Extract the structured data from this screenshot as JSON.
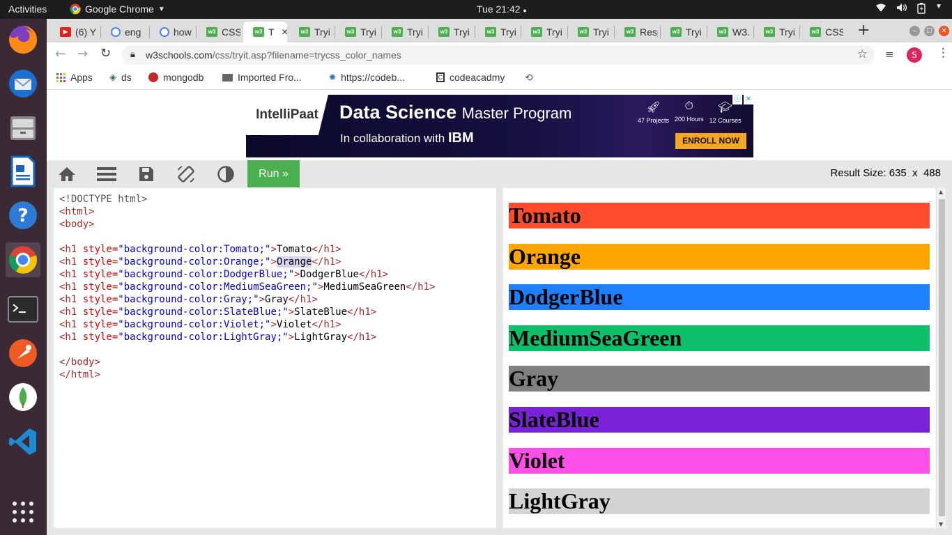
{
  "system": {
    "activities": "Activities",
    "app_name": "Google Chrome",
    "clock": "Tue 21:42"
  },
  "tabs": [
    {
      "label": "(6) Y",
      "icon": "youtube-icon"
    },
    {
      "label": "eng",
      "icon": "google-icon"
    },
    {
      "label": "how",
      "icon": "google-icon"
    },
    {
      "label": "CSS",
      "icon": "w3schools-icon"
    },
    {
      "label": "T",
      "icon": "w3schools-icon",
      "active": true
    },
    {
      "label": "Tryi",
      "icon": "w3schools-icon"
    },
    {
      "label": "Tryi",
      "icon": "w3schools-icon"
    },
    {
      "label": "Tryi",
      "icon": "w3schools-icon"
    },
    {
      "label": "Tryi",
      "icon": "w3schools-icon"
    },
    {
      "label": "Tryi",
      "icon": "w3schools-icon"
    },
    {
      "label": "Tryi",
      "icon": "w3schools-icon"
    },
    {
      "label": "Tryi",
      "icon": "w3schools-icon"
    },
    {
      "label": "Resp",
      "icon": "w3schools-icon"
    },
    {
      "label": "Tryi",
      "icon": "w3schools-icon"
    },
    {
      "label": "W3.",
      "icon": "w3schools-icon"
    },
    {
      "label": "Tryi",
      "icon": "w3schools-icon"
    },
    {
      "label": "CSS",
      "icon": "w3schools-icon"
    }
  ],
  "address": {
    "host": "w3schools.com",
    "path": "/css/tryit.asp?filename=trycss_color_names",
    "profile_initial": "S"
  },
  "bookmarks": [
    {
      "label": "Apps",
      "icon": "apps-grid-icon"
    },
    {
      "label": "ds",
      "icon": "diamond-icon"
    },
    {
      "label": "mongodb",
      "icon": "mongodb-icon"
    },
    {
      "label": "Imported Fro...",
      "icon": "folder-icon"
    },
    {
      "label": "https://codeb...",
      "icon": "codebeautify-icon"
    },
    {
      "label": "codeacadmy",
      "icon": "codecademy-icon"
    }
  ],
  "ad": {
    "logo": "IntelliPaat",
    "headline_bold": "Data Science",
    "headline_rest": "Master Program",
    "collab": "In collaboration with",
    "partner": "IBM",
    "stats": [
      "47 Projects",
      "200 Hours",
      "12 Courses"
    ],
    "cta": "ENROLL NOW"
  },
  "toolbar": {
    "run_label": "Run »",
    "result_size_label": "Result Size:",
    "result_width": "635",
    "times": "x",
    "result_height": "488"
  },
  "code_lines": [
    [
      {
        "t": "doc",
        "s": "<!DOCTYPE html>"
      }
    ],
    [
      {
        "t": "tag",
        "s": "<html>"
      }
    ],
    [
      {
        "t": "tag",
        "s": "<body>"
      }
    ],
    [],
    [
      {
        "t": "tag",
        "s": "<h1 "
      },
      {
        "t": "attr",
        "s": "style="
      },
      {
        "t": "val",
        "s": "\"background-color:Tomato;\""
      },
      {
        "t": "tag",
        "s": ">"
      },
      {
        "t": "txt",
        "s": "Tomato"
      },
      {
        "t": "tag",
        "s": "</h1>"
      }
    ],
    [
      {
        "t": "tag",
        "s": "<h1 "
      },
      {
        "t": "attr",
        "s": "style="
      },
      {
        "t": "val",
        "s": "\"background-color:Orange;\""
      },
      {
        "t": "tag",
        "s": ">"
      },
      {
        "t": "txt",
        "s": "Orange"
      },
      {
        "t": "tag",
        "s": "</h1>"
      }
    ],
    [
      {
        "t": "tag",
        "s": "<h1 "
      },
      {
        "t": "attr",
        "s": "style="
      },
      {
        "t": "val",
        "s": "\"background-color:DodgerBlue;\""
      },
      {
        "t": "tag",
        "s": ">"
      },
      {
        "t": "txt",
        "s": "DodgerBlue"
      },
      {
        "t": "tag",
        "s": "</h1>"
      }
    ],
    [
      {
        "t": "tag",
        "s": "<h1 "
      },
      {
        "t": "attr",
        "s": "style="
      },
      {
        "t": "val",
        "s": "\"background-color:MediumSeaGreen;\""
      },
      {
        "t": "tag",
        "s": ">"
      },
      {
        "t": "txt",
        "s": "MediumSeaGreen"
      },
      {
        "t": "tag",
        "s": "</h1>"
      }
    ],
    [
      {
        "t": "tag",
        "s": "<h1 "
      },
      {
        "t": "attr",
        "s": "style="
      },
      {
        "t": "val",
        "s": "\"background-color:Gray;\""
      },
      {
        "t": "tag",
        "s": ">"
      },
      {
        "t": "txt",
        "s": "Gray"
      },
      {
        "t": "tag",
        "s": "</h1>"
      }
    ],
    [
      {
        "t": "tag",
        "s": "<h1 "
      },
      {
        "t": "attr",
        "s": "style="
      },
      {
        "t": "val",
        "s": "\"background-color:SlateBlue;\""
      },
      {
        "t": "tag",
        "s": ">"
      },
      {
        "t": "txt",
        "s": "SlateBlue"
      },
      {
        "t": "tag",
        "s": "</h1>"
      }
    ],
    [
      {
        "t": "tag",
        "s": "<h1 "
      },
      {
        "t": "attr",
        "s": "style="
      },
      {
        "t": "val",
        "s": "\"background-color:Violet;\""
      },
      {
        "t": "tag",
        "s": ">"
      },
      {
        "t": "txt",
        "s": "Violet"
      },
      {
        "t": "tag",
        "s": "</h1>"
      }
    ],
    [
      {
        "t": "tag",
        "s": "<h1 "
      },
      {
        "t": "attr",
        "s": "style="
      },
      {
        "t": "val",
        "s": "\"background-color:LightGray;\""
      },
      {
        "t": "tag",
        "s": ">"
      },
      {
        "t": "txt",
        "s": "LightGray"
      },
      {
        "t": "tag",
        "s": "</h1>"
      }
    ],
    [],
    [
      {
        "t": "tag",
        "s": "</body>"
      }
    ],
    [
      {
        "t": "tag",
        "s": "</html>"
      }
    ]
  ],
  "result_headings": [
    {
      "text": "Tomato",
      "color": "#ff4b2b"
    },
    {
      "text": "Orange",
      "color": "#ffa500"
    },
    {
      "text": "DodgerBlue",
      "color": "#1e7fff"
    },
    {
      "text": "MediumSeaGreen",
      "color": "#0ec06c"
    },
    {
      "text": "Gray",
      "color": "#808080"
    },
    {
      "text": "SlateBlue",
      "color": "#7a22d8"
    },
    {
      "text": "Violet",
      "color": "#ff4fe9"
    },
    {
      "text": "LightGray",
      "color": "#d3d3d3"
    }
  ]
}
